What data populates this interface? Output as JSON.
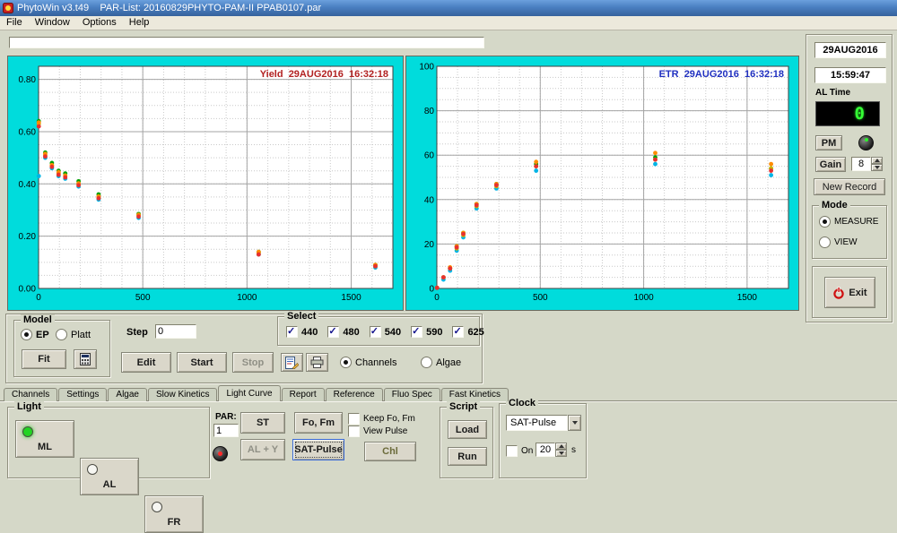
{
  "window": {
    "title": "PhytoWin v3.t49    PAR-List: 20160829PHYTO-PAM-II PPAB0107.par"
  },
  "menu": {
    "items": [
      "File",
      "Window",
      "Options",
      "Help"
    ]
  },
  "message_bar": {
    "value": ""
  },
  "chart_data": [
    {
      "type": "scatter",
      "title": "Yield",
      "datetime": "29AUG2016  16:32:18",
      "title_color": "#b22222",
      "xlabel": "",
      "ylabel": "",
      "xlim": [
        0,
        1700
      ],
      "ylim": [
        0,
        0.85
      ],
      "xticks": [
        0,
        500,
        1000,
        1500
      ],
      "yticks": [
        0,
        0.2,
        0.4,
        0.6,
        0.8
      ],
      "y_decimals": 2,
      "x_minor": 100,
      "y_minor": 0.05,
      "grid": true,
      "legend": false,
      "x": [
        1,
        32,
        64,
        96,
        128,
        192,
        288,
        480,
        1056,
        1616
      ],
      "series": [
        {
          "name": "440",
          "color": "#00b4e6",
          "values": [
            0.43,
            0.5,
            0.46,
            0.43,
            0.42,
            0.39,
            0.34,
            0.27,
            0.13,
            0.08
          ]
        },
        {
          "name": "480",
          "color": "#00a000",
          "values": [
            0.64,
            0.52,
            0.48,
            0.45,
            0.44,
            0.41,
            0.36,
            0.285,
            0.14,
            0.09
          ]
        },
        {
          "name": "540",
          "color": "#c8b400",
          "values": [
            0.63,
            0.51,
            0.47,
            0.44,
            0.43,
            0.4,
            0.35,
            0.28,
            0.135,
            0.085
          ]
        },
        {
          "name": "590",
          "color": "#ff8c00",
          "values": [
            0.635,
            0.515,
            0.472,
            0.445,
            0.432,
            0.402,
            0.352,
            0.282,
            0.14,
            0.09
          ]
        },
        {
          "name": "625",
          "color": "#e83030",
          "values": [
            0.62,
            0.505,
            0.465,
            0.435,
            0.425,
            0.395,
            0.345,
            0.275,
            0.13,
            0.085
          ]
        }
      ]
    },
    {
      "type": "scatter",
      "title": "ETR",
      "datetime": "29AUG2016  16:32:18",
      "title_color": "#2030c0",
      "xlabel": "",
      "ylabel": "",
      "xlim": [
        0,
        1700
      ],
      "ylim": [
        0,
        100
      ],
      "xticks": [
        0,
        500,
        1000,
        1500
      ],
      "yticks": [
        0,
        20,
        40,
        60,
        80,
        100
      ],
      "y_decimals": 0,
      "x_minor": 100,
      "y_minor": 5,
      "grid": true,
      "legend": false,
      "x": [
        1,
        32,
        64,
        96,
        128,
        192,
        288,
        480,
        1056,
        1616
      ],
      "series": [
        {
          "name": "440",
          "color": "#00b4e6",
          "values": [
            0.2,
            4,
            8,
            17,
            23,
            36,
            45,
            53,
            56,
            51
          ]
        },
        {
          "name": "480",
          "color": "#00a000",
          "values": [
            0.3,
            5,
            9,
            19,
            25,
            38,
            47,
            56,
            59,
            54
          ]
        },
        {
          "name": "540",
          "color": "#c8b400",
          "values": [
            0.3,
            5,
            9,
            18,
            24,
            37,
            46,
            55,
            58,
            54
          ]
        },
        {
          "name": "590",
          "color": "#ff8c00",
          "values": [
            0.3,
            5,
            9.5,
            19,
            25,
            38,
            47,
            57,
            61,
            56
          ]
        },
        {
          "name": "625",
          "color": "#e83030",
          "values": [
            0.3,
            5,
            9,
            18.5,
            24.5,
            37.5,
            46.5,
            55,
            58,
            53
          ]
        }
      ]
    }
  ],
  "sidebar": {
    "date": "29AUG2016",
    "time": "15:59:47",
    "al_time_label": "AL Time",
    "al_time_value": "0",
    "pm_button": "PM",
    "gain_label": "Gain",
    "gain_value": "8",
    "new_record_button": "New Record",
    "mode_group": {
      "label": "Mode",
      "options": [
        "MEASURE",
        "VIEW"
      ],
      "selected": "MEASURE"
    },
    "exit_button": "Exit"
  },
  "controls": {
    "model_group": {
      "label": "Model",
      "options": [
        "EP",
        "Platt"
      ],
      "selected": "EP",
      "fit_button": "Fit"
    },
    "step_label": "Step",
    "step_value": "0",
    "edit_button": "Edit",
    "start_button": "Start",
    "stop_button": "Stop",
    "select_group": {
      "label": "Select",
      "items": [
        {
          "label": "440",
          "checked": true
        },
        {
          "label": "480",
          "checked": true
        },
        {
          "label": "540",
          "checked": true
        },
        {
          "label": "590",
          "checked": true
        },
        {
          "label": "625",
          "checked": true
        }
      ]
    },
    "view_radios": {
      "options": [
        "Channels",
        "Algae"
      ],
      "selected": "Channels"
    }
  },
  "tabs": {
    "items": [
      "Channels",
      "Settings",
      "Algae",
      "Slow Kinetics",
      "Light Curve",
      "Report",
      "Reference",
      "Fluo Spec",
      "Fast Kinetics"
    ],
    "active": "Light Curve"
  },
  "light_panel": {
    "label": "Light",
    "ml_button": "ML",
    "al_button": "AL",
    "fr_button": "FR",
    "par_label": "PAR:",
    "par_value": "1",
    "st_button": "ST",
    "aly_button": "AL + Y",
    "fofm_button": "Fo, Fm",
    "satpulse_button": "SAT-Pulse",
    "keep_checkbox": "Keep Fo, Fm",
    "view_checkbox": "View Pulse",
    "chl_button": "Chl"
  },
  "script_panel": {
    "label": "Script",
    "load_button": "Load",
    "run_button": "Run"
  },
  "clock_panel": {
    "label": "Clock",
    "mode_value": "SAT-Pulse",
    "on_label": "On",
    "interval_value": "20",
    "unit_label": "s"
  }
}
